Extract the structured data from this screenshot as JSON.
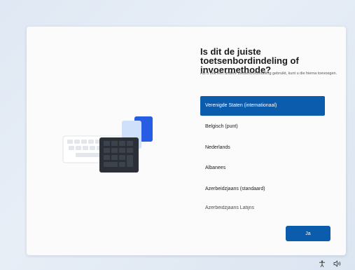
{
  "setup": {
    "title": "Is dit de juiste toetsenbordindeling of invoermethode?",
    "subtitle": "Als u ook een andere toetsenbordindeling gebruikt, kunt u die hierna toevoegen.",
    "layouts": [
      {
        "label": "Verenigde Staten (internationaal)",
        "selected": true
      },
      {
        "label": "Belgisch (punt)",
        "selected": false
      },
      {
        "label": "Nederlands",
        "selected": false
      },
      {
        "label": "Albanees",
        "selected": false
      },
      {
        "label": "Azerbeidzjaans (standaard)",
        "selected": false
      },
      {
        "label": "Azerbeidzjaans Latijns",
        "selected": false
      }
    ],
    "confirm_label": "Ja"
  },
  "taskbar": {
    "icons": [
      "accessibility-icon",
      "volume-icon"
    ]
  },
  "colors": {
    "accent": "#0b5cad",
    "card": "#fbfbfc",
    "background": "#dfe8f4"
  }
}
